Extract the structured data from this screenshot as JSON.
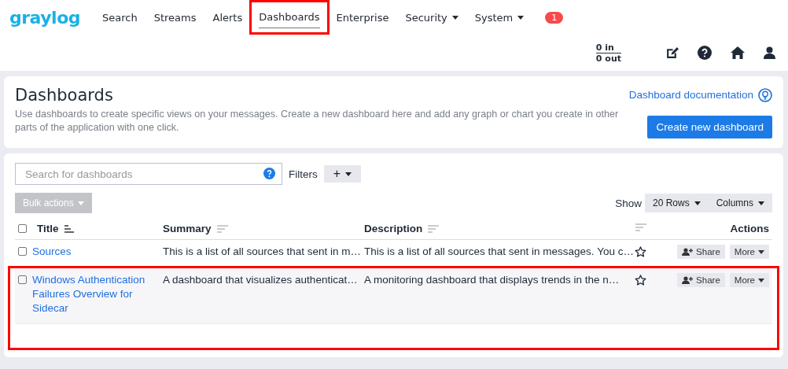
{
  "nav": {
    "logo": "graylog",
    "items": [
      {
        "label": "Search",
        "selected": false,
        "dropdown": false,
        "highlighted": false
      },
      {
        "label": "Streams",
        "selected": false,
        "dropdown": false,
        "highlighted": false
      },
      {
        "label": "Alerts",
        "selected": false,
        "dropdown": false,
        "highlighted": false
      },
      {
        "label": "Dashboards",
        "selected": true,
        "dropdown": false,
        "highlighted": true
      },
      {
        "label": "Enterprise",
        "selected": false,
        "dropdown": false,
        "highlighted": false
      },
      {
        "label": "Security",
        "selected": false,
        "dropdown": true,
        "highlighted": false
      },
      {
        "label": "System",
        "selected": false,
        "dropdown": true,
        "highlighted": false
      }
    ],
    "notification_count": "1",
    "throughput_in": "0 in",
    "throughput_out": "0 out"
  },
  "page_header": {
    "title": "Dashboards",
    "description": "Use dashboards to create specific views on your messages. Create a new dashboard here and add any graph or chart you create in other parts of the application with one click.",
    "doc_link": "Dashboard documentation",
    "create_button": "Create new dashboard"
  },
  "toolbar": {
    "search_placeholder": "Search for dashboards",
    "filters_label": "Filters",
    "filters_button": "+",
    "bulk_actions": "Bulk actions",
    "show_label": "Show",
    "rows_button": "20 Rows",
    "columns_button": "Columns"
  },
  "table": {
    "select_all_checked": false,
    "columns": [
      "Title",
      "Summary",
      "Description",
      "Actions"
    ],
    "rows": [
      {
        "title": "Sources",
        "summary": "This is a list of all sources that sent in m…",
        "description": "This is a list of all sources that sent in messages. You c…",
        "checked": false,
        "starred": false,
        "hovered": false,
        "highlighted": false,
        "share": "Share",
        "more": "More"
      },
      {
        "title": "Windows Authentication Failures Overview for Sidecar",
        "summary": "A dashboard that visualizes authenticat…",
        "description": "A monitoring dashboard that displays trends in the n…",
        "checked": false,
        "starred": false,
        "hovered": true,
        "highlighted": true,
        "share": "Share",
        "more": "More"
      }
    ]
  }
}
